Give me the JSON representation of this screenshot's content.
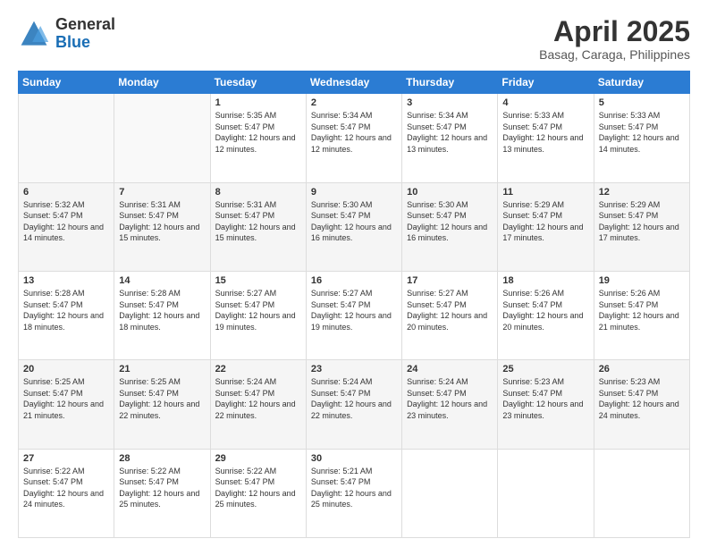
{
  "header": {
    "logo_general": "General",
    "logo_blue": "Blue",
    "month": "April 2025",
    "location": "Basag, Caraga, Philippines"
  },
  "days_of_week": [
    "Sunday",
    "Monday",
    "Tuesday",
    "Wednesday",
    "Thursday",
    "Friday",
    "Saturday"
  ],
  "weeks": [
    [
      {
        "num": "",
        "sunrise": "",
        "sunset": "",
        "daylight": ""
      },
      {
        "num": "",
        "sunrise": "",
        "sunset": "",
        "daylight": ""
      },
      {
        "num": "1",
        "sunrise": "Sunrise: 5:35 AM",
        "sunset": "Sunset: 5:47 PM",
        "daylight": "Daylight: 12 hours and 12 minutes."
      },
      {
        "num": "2",
        "sunrise": "Sunrise: 5:34 AM",
        "sunset": "Sunset: 5:47 PM",
        "daylight": "Daylight: 12 hours and 12 minutes."
      },
      {
        "num": "3",
        "sunrise": "Sunrise: 5:34 AM",
        "sunset": "Sunset: 5:47 PM",
        "daylight": "Daylight: 12 hours and 13 minutes."
      },
      {
        "num": "4",
        "sunrise": "Sunrise: 5:33 AM",
        "sunset": "Sunset: 5:47 PM",
        "daylight": "Daylight: 12 hours and 13 minutes."
      },
      {
        "num": "5",
        "sunrise": "Sunrise: 5:33 AM",
        "sunset": "Sunset: 5:47 PM",
        "daylight": "Daylight: 12 hours and 14 minutes."
      }
    ],
    [
      {
        "num": "6",
        "sunrise": "Sunrise: 5:32 AM",
        "sunset": "Sunset: 5:47 PM",
        "daylight": "Daylight: 12 hours and 14 minutes."
      },
      {
        "num": "7",
        "sunrise": "Sunrise: 5:31 AM",
        "sunset": "Sunset: 5:47 PM",
        "daylight": "Daylight: 12 hours and 15 minutes."
      },
      {
        "num": "8",
        "sunrise": "Sunrise: 5:31 AM",
        "sunset": "Sunset: 5:47 PM",
        "daylight": "Daylight: 12 hours and 15 minutes."
      },
      {
        "num": "9",
        "sunrise": "Sunrise: 5:30 AM",
        "sunset": "Sunset: 5:47 PM",
        "daylight": "Daylight: 12 hours and 16 minutes."
      },
      {
        "num": "10",
        "sunrise": "Sunrise: 5:30 AM",
        "sunset": "Sunset: 5:47 PM",
        "daylight": "Daylight: 12 hours and 16 minutes."
      },
      {
        "num": "11",
        "sunrise": "Sunrise: 5:29 AM",
        "sunset": "Sunset: 5:47 PM",
        "daylight": "Daylight: 12 hours and 17 minutes."
      },
      {
        "num": "12",
        "sunrise": "Sunrise: 5:29 AM",
        "sunset": "Sunset: 5:47 PM",
        "daylight": "Daylight: 12 hours and 17 minutes."
      }
    ],
    [
      {
        "num": "13",
        "sunrise": "Sunrise: 5:28 AM",
        "sunset": "Sunset: 5:47 PM",
        "daylight": "Daylight: 12 hours and 18 minutes."
      },
      {
        "num": "14",
        "sunrise": "Sunrise: 5:28 AM",
        "sunset": "Sunset: 5:47 PM",
        "daylight": "Daylight: 12 hours and 18 minutes."
      },
      {
        "num": "15",
        "sunrise": "Sunrise: 5:27 AM",
        "sunset": "Sunset: 5:47 PM",
        "daylight": "Daylight: 12 hours and 19 minutes."
      },
      {
        "num": "16",
        "sunrise": "Sunrise: 5:27 AM",
        "sunset": "Sunset: 5:47 PM",
        "daylight": "Daylight: 12 hours and 19 minutes."
      },
      {
        "num": "17",
        "sunrise": "Sunrise: 5:27 AM",
        "sunset": "Sunset: 5:47 PM",
        "daylight": "Daylight: 12 hours and 20 minutes."
      },
      {
        "num": "18",
        "sunrise": "Sunrise: 5:26 AM",
        "sunset": "Sunset: 5:47 PM",
        "daylight": "Daylight: 12 hours and 20 minutes."
      },
      {
        "num": "19",
        "sunrise": "Sunrise: 5:26 AM",
        "sunset": "Sunset: 5:47 PM",
        "daylight": "Daylight: 12 hours and 21 minutes."
      }
    ],
    [
      {
        "num": "20",
        "sunrise": "Sunrise: 5:25 AM",
        "sunset": "Sunset: 5:47 PM",
        "daylight": "Daylight: 12 hours and 21 minutes."
      },
      {
        "num": "21",
        "sunrise": "Sunrise: 5:25 AM",
        "sunset": "Sunset: 5:47 PM",
        "daylight": "Daylight: 12 hours and 22 minutes."
      },
      {
        "num": "22",
        "sunrise": "Sunrise: 5:24 AM",
        "sunset": "Sunset: 5:47 PM",
        "daylight": "Daylight: 12 hours and 22 minutes."
      },
      {
        "num": "23",
        "sunrise": "Sunrise: 5:24 AM",
        "sunset": "Sunset: 5:47 PM",
        "daylight": "Daylight: 12 hours and 22 minutes."
      },
      {
        "num": "24",
        "sunrise": "Sunrise: 5:24 AM",
        "sunset": "Sunset: 5:47 PM",
        "daylight": "Daylight: 12 hours and 23 minutes."
      },
      {
        "num": "25",
        "sunrise": "Sunrise: 5:23 AM",
        "sunset": "Sunset: 5:47 PM",
        "daylight": "Daylight: 12 hours and 23 minutes."
      },
      {
        "num": "26",
        "sunrise": "Sunrise: 5:23 AM",
        "sunset": "Sunset: 5:47 PM",
        "daylight": "Daylight: 12 hours and 24 minutes."
      }
    ],
    [
      {
        "num": "27",
        "sunrise": "Sunrise: 5:22 AM",
        "sunset": "Sunset: 5:47 PM",
        "daylight": "Daylight: 12 hours and 24 minutes."
      },
      {
        "num": "28",
        "sunrise": "Sunrise: 5:22 AM",
        "sunset": "Sunset: 5:47 PM",
        "daylight": "Daylight: 12 hours and 25 minutes."
      },
      {
        "num": "29",
        "sunrise": "Sunrise: 5:22 AM",
        "sunset": "Sunset: 5:47 PM",
        "daylight": "Daylight: 12 hours and 25 minutes."
      },
      {
        "num": "30",
        "sunrise": "Sunrise: 5:21 AM",
        "sunset": "Sunset: 5:47 PM",
        "daylight": "Daylight: 12 hours and 25 minutes."
      },
      {
        "num": "",
        "sunrise": "",
        "sunset": "",
        "daylight": ""
      },
      {
        "num": "",
        "sunrise": "",
        "sunset": "",
        "daylight": ""
      },
      {
        "num": "",
        "sunrise": "",
        "sunset": "",
        "daylight": ""
      }
    ]
  ]
}
